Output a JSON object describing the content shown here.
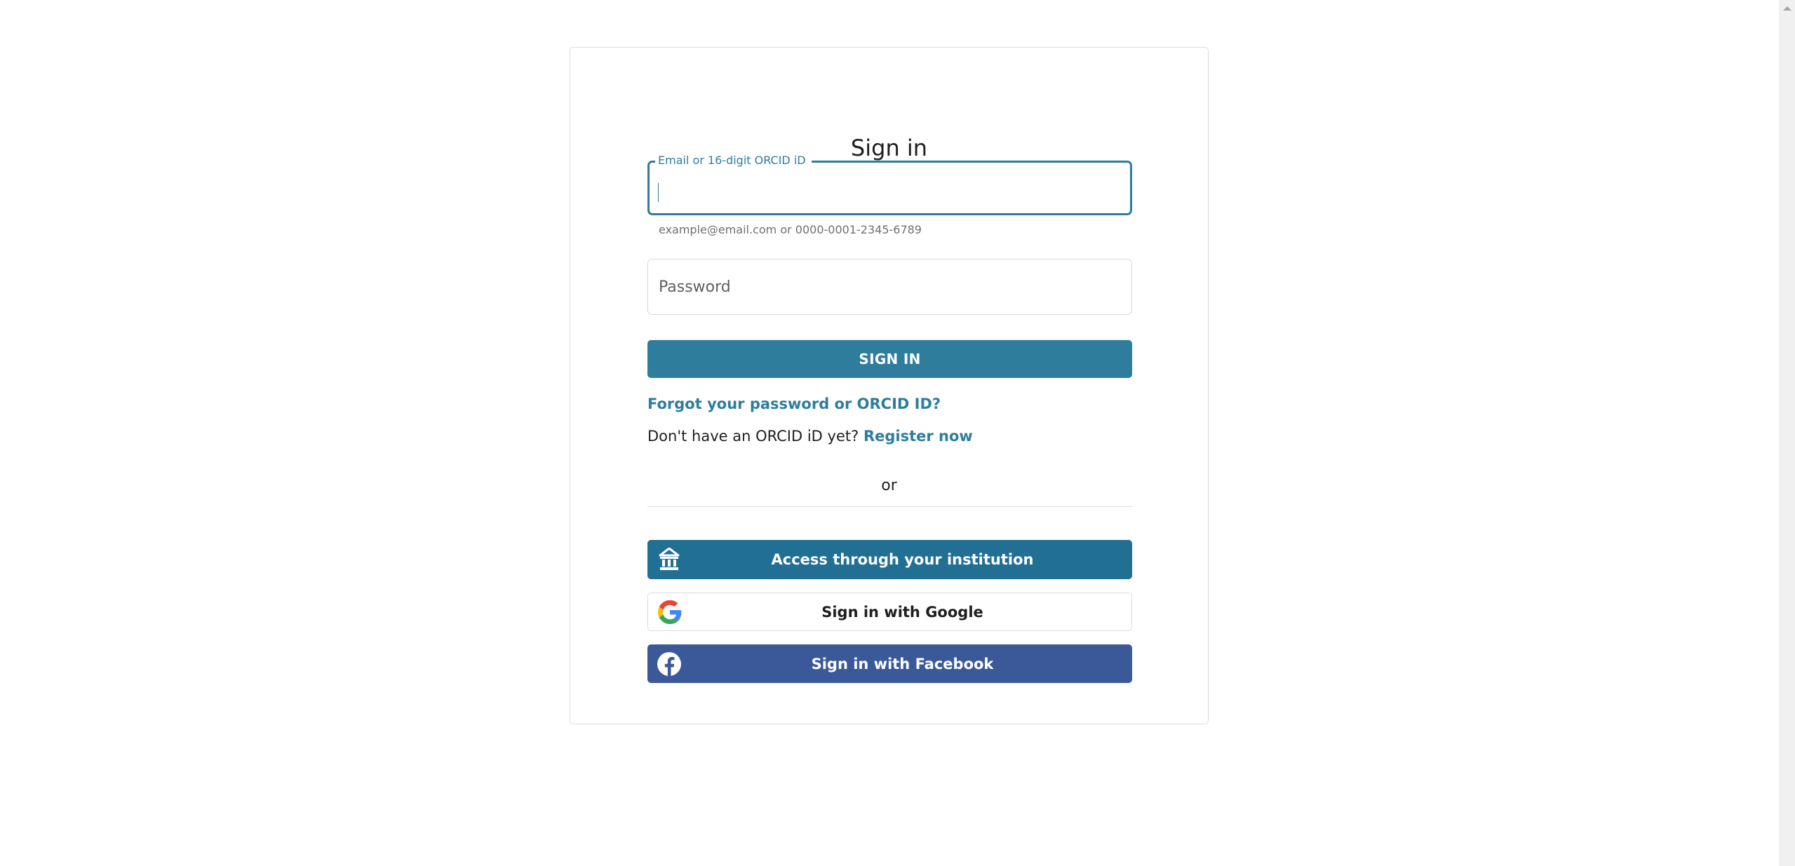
{
  "page": {
    "title": "Sign in"
  },
  "form": {
    "email": {
      "label": "Email or 16-digit ORCID iD",
      "value": "",
      "helper": "example@email.com or 0000-0001-2345-6789",
      "focused": true
    },
    "password": {
      "placeholder": "Password",
      "value": ""
    },
    "signin_label": "SIGN IN",
    "forgot_link": "Forgot your password or ORCID ID?",
    "register_prompt": "Don't have an ORCID iD yet?",
    "register_link": "Register now",
    "or_text": "or"
  },
  "alternatives": [
    {
      "label": "Access through your institution",
      "icon": "institution-icon",
      "color": "#216f93"
    },
    {
      "label": "Sign in with Google",
      "icon": "google-icon",
      "color": "#ffffff"
    },
    {
      "label": "Sign in with Facebook",
      "icon": "facebook-icon",
      "color": "#3b5998"
    }
  ],
  "colors": {
    "accent": "#2e7d9c",
    "institution": "#216f93",
    "facebook": "#3b5998"
  }
}
